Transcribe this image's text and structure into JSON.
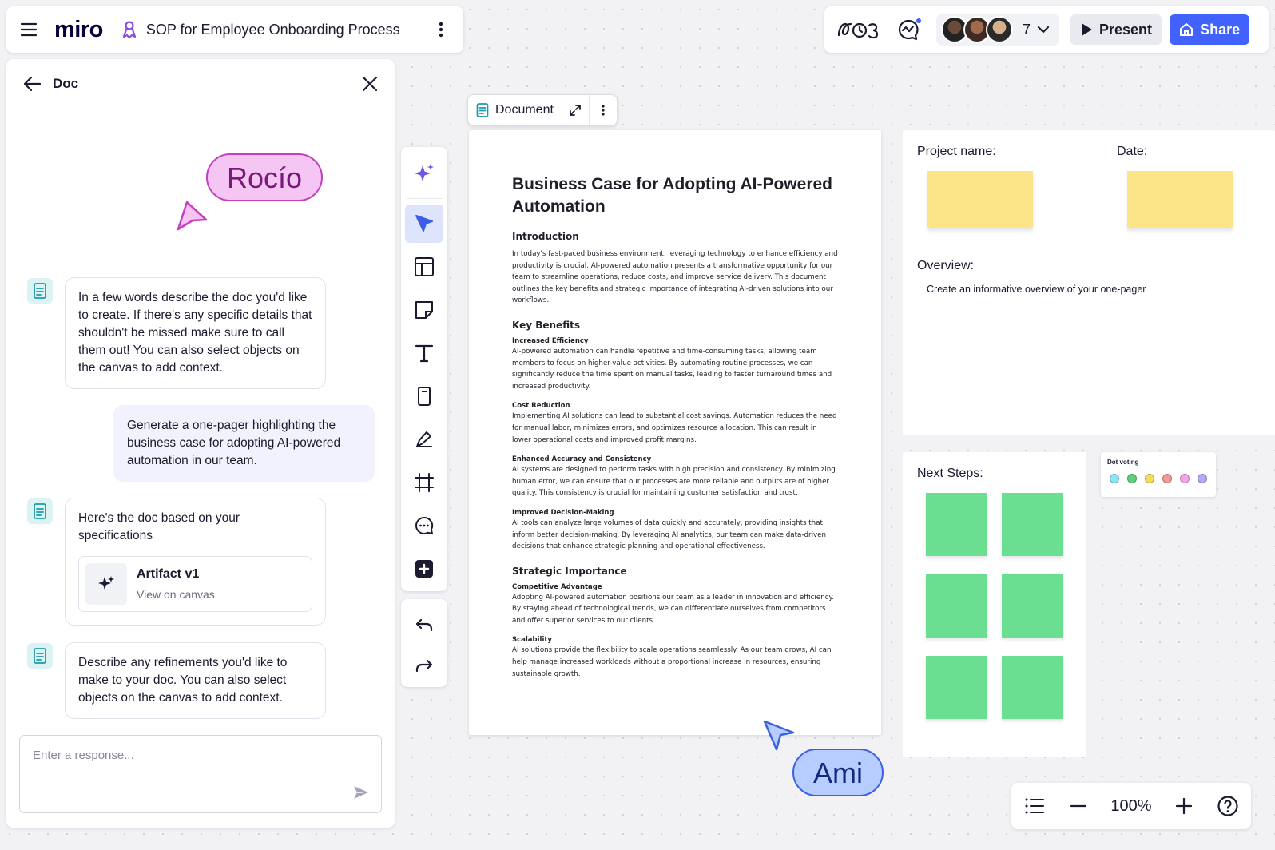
{
  "topbar": {
    "logo": "miro",
    "board_title": "SOP for Employee Onboarding Process",
    "collaborator_count": "7",
    "present_label": "Present",
    "share_label": "Share"
  },
  "doc_panel": {
    "title": "Doc",
    "messages": [
      {
        "role": "assistant",
        "text": "In a few words describe the doc you'd like to create. If there's any specific details that shouldn't be missed make sure to call them out! You can also select objects on the canvas to add context."
      },
      {
        "role": "user",
        "text": "Generate a one-pager highlighting the business case for adopting AI-powered automation in our team."
      },
      {
        "role": "assistant",
        "text": "Here's the doc based on your specifications",
        "artifact": {
          "name": "Artifact v1",
          "subtitle": "View on canvas"
        }
      },
      {
        "role": "assistant",
        "text": "Describe any refinements you'd like to make to your doc. You can also select objects on the canvas to add context."
      }
    ],
    "input_placeholder": "Enter a response..."
  },
  "cursors": {
    "rocio": "Rocío",
    "ami": "Ami"
  },
  "doc_chip": {
    "label": "Document"
  },
  "document": {
    "title": "Business Case for Adopting AI-Powered Automation",
    "intro_heading": "Introduction",
    "intro_text": "In today's fast-paced business environment, leveraging technology to enhance efficiency and productivity is crucial. AI-powered automation presents a transformative opportunity for our team to streamline operations, reduce costs, and improve service delivery. This document outlines the key benefits and strategic importance of integrating AI-driven solutions into our workflows.",
    "benefits_heading": "Key Benefits",
    "benefits": [
      {
        "title": "Increased Efficiency",
        "text": "AI-powered automation can handle repetitive and time-consuming tasks, allowing team members to focus on higher-value activities. By automating routine processes, we can significantly reduce the time spent on manual tasks, leading to faster turnaround times and increased productivity."
      },
      {
        "title": "Cost Reduction",
        "text": "Implementing AI solutions can lead to substantial cost savings. Automation reduces the need for manual labor, minimizes errors, and optimizes resource allocation. This can result in lower operational costs and improved profit margins."
      },
      {
        "title": "Enhanced Accuracy and Consistency",
        "text": "AI systems are designed to perform tasks with high precision and consistency. By minimizing human error, we can ensure that our processes are more reliable and outputs are of higher quality. This consistency is crucial for maintaining customer satisfaction and trust."
      },
      {
        "title": "Improved Decision-Making",
        "text": "AI tools can analyze large volumes of data quickly and accurately, providing insights that inform better decision-making. By leveraging AI analytics, our team can make data-driven decisions that enhance strategic planning and operational effectiveness."
      }
    ],
    "strategic_heading": "Strategic Importance",
    "strategic": [
      {
        "title": "Competitive Advantage",
        "text": "Adopting AI-powered automation positions our team as a leader in innovation and efficiency. By staying ahead of technological trends, we can differentiate ourselves from competitors and offer superior services to our clients."
      },
      {
        "title": "Scalability",
        "text": "AI solutions provide the flexibility to scale operations seamlessly. As our team grows, AI can help manage increased workloads without a proportional increase in resources, ensuring sustainable growth."
      }
    ]
  },
  "onepager": {
    "project_label": "Project name:",
    "date_label": "Date:",
    "overview_label": "Overview:",
    "overview_text": "Create an informative overview of your one-pager"
  },
  "next_steps": {
    "label": "Next Steps:"
  },
  "dot_voting": {
    "title": "Dot voting",
    "colors": [
      "#8fe3f5",
      "#5ed07a",
      "#f5dc5a",
      "#f2999a",
      "#f4a4ec",
      "#b7a8f5"
    ]
  },
  "zoom": {
    "value": "100%"
  },
  "colors": {
    "accent": "#4262ff",
    "rocio_cursor": "#e07ad8",
    "ami_cursor": "#5b86f0",
    "sticky_yellow": "#fce588",
    "sticky_green": "#6adf92"
  }
}
